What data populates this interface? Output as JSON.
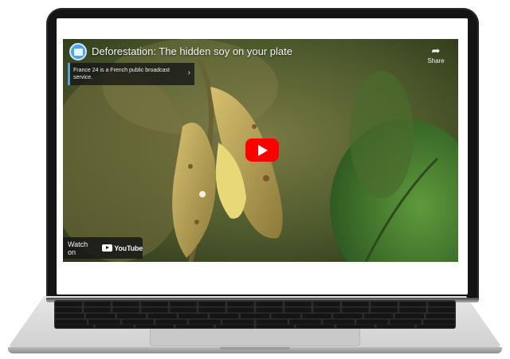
{
  "video": {
    "title": "Deforestation: The hidden soy on your plate",
    "info_panel_text": "France 24 is a French public broadcast service.",
    "share_label": "Share",
    "watch_on_label": "Watch on",
    "youtube_wordmark": "YouTube"
  },
  "icons": {
    "channel_avatar": "france24-logo-icon",
    "share": "share-arrow-icon",
    "play": "play-icon",
    "info_chevron": "chevron-right-icon",
    "youtube_logo": "youtube-logo-icon"
  },
  "colors": {
    "play_button": "#ff0000",
    "laptop_bezel": "#141414",
    "laptop_body": "#dcdcdc",
    "info_accent": "#5aa0d8"
  }
}
